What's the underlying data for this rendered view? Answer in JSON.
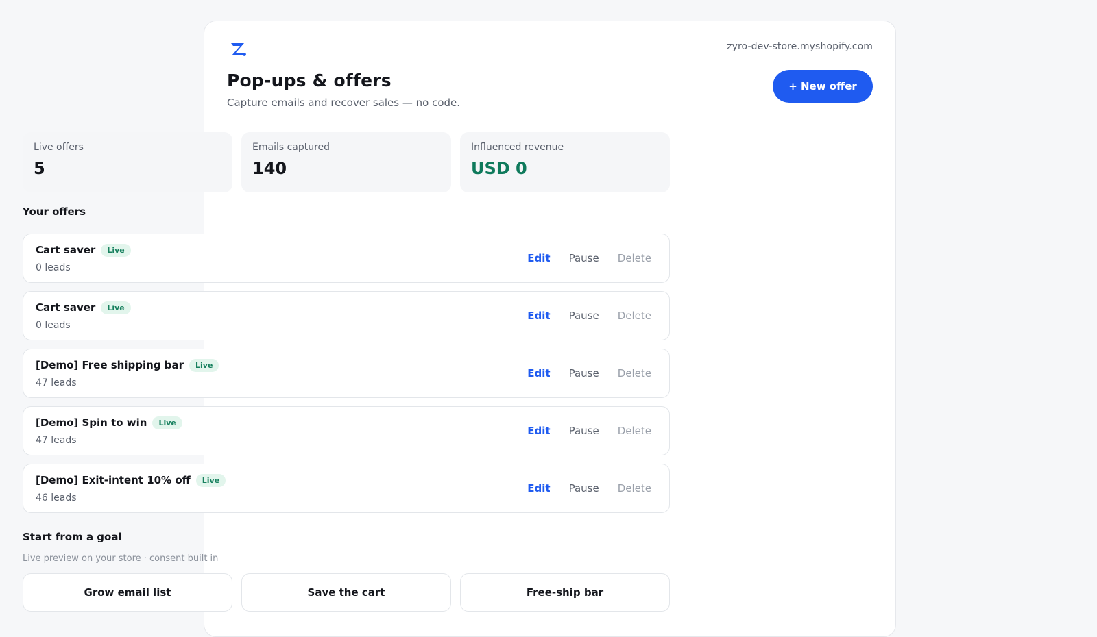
{
  "brand": {
    "logo_icon": "zyro-z-logo-icon",
    "accent_color": "#1f5bf0"
  },
  "store": {
    "domain": "zyro-dev-store.myshopify.com"
  },
  "header": {
    "title": "Pop-ups & offers",
    "subtitle": "Capture emails and recover sales — no code.",
    "new_offer_label": "+ New offer"
  },
  "stats": [
    {
      "label": "Live offers",
      "value": "5"
    },
    {
      "label": "Emails captured",
      "value": "140"
    },
    {
      "label": "Influenced revenue",
      "value": "USD 0",
      "color": "#0f7a5c"
    }
  ],
  "offers_section": {
    "title": "Your offers",
    "actions": {
      "edit": "Edit",
      "pause": "Pause",
      "delete": "Delete"
    },
    "items": [
      {
        "name": "Cart saver",
        "status": "Live",
        "leads": "0 leads"
      },
      {
        "name": "Cart saver",
        "status": "Live",
        "leads": "0 leads"
      },
      {
        "name": "[Demo] Free shipping bar",
        "status": "Live",
        "leads": "47 leads"
      },
      {
        "name": "[Demo] Spin to win",
        "status": "Live",
        "leads": "47 leads"
      },
      {
        "name": "[Demo] Exit-intent 10% off",
        "status": "Live",
        "leads": "46 leads"
      }
    ]
  },
  "goals_section": {
    "title": "Start from a goal",
    "hint": "Live preview on your store · consent built in",
    "goals": [
      {
        "label": "Grow email list"
      },
      {
        "label": "Save the cart"
      },
      {
        "label": "Free-ship bar"
      }
    ]
  }
}
